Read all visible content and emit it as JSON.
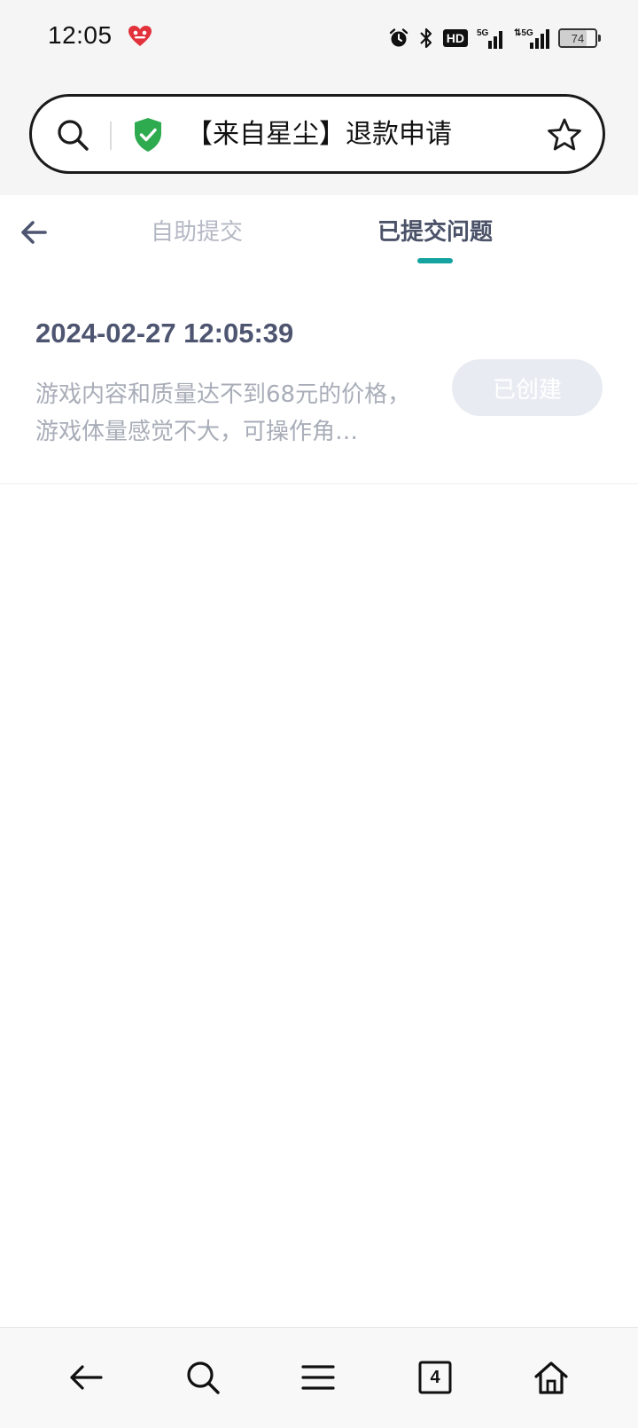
{
  "status_bar": {
    "time": "12:05",
    "battery": "74",
    "battery_level": 0.74,
    "hd_label": "HD",
    "icons": [
      "app-badge-icon",
      "alarm-icon",
      "bluetooth-icon",
      "hd-voice-icon",
      "signal-5g-icon",
      "signal-5g-data-icon",
      "battery-icon"
    ]
  },
  "url_bar": {
    "title": "【来自星尘】退款申请",
    "icons": [
      "search-icon",
      "shield-check-icon",
      "star-icon"
    ],
    "shield_color": "#2eaa4f"
  },
  "tabs": {
    "self_submit": "自助提交",
    "submitted": "已提交问题",
    "active": "submitted",
    "indicator_color": "#14a3a0"
  },
  "tickets": [
    {
      "time": "2024-02-27 12:05:39",
      "description": "游戏内容和质量达不到68元的价格，游戏体量感觉不大，可操作角…",
      "status": "已创建"
    }
  ],
  "bottom_nav": {
    "tab_count": "4",
    "icons": [
      "back-icon",
      "search-icon",
      "menu-icon",
      "tabs-icon",
      "home-icon"
    ]
  }
}
